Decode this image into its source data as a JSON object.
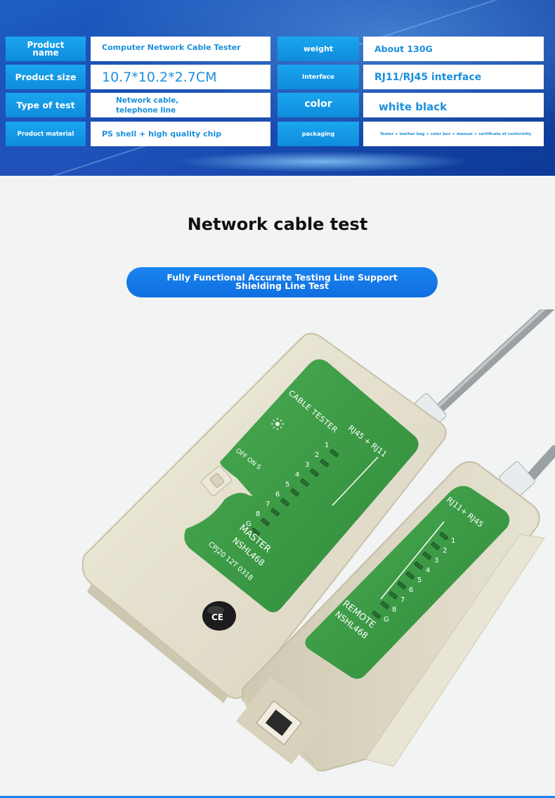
{
  "specs": {
    "product_name": {
      "label": "Product name",
      "value": "Computer Network Cable Tester"
    },
    "weight": {
      "label": "weight",
      "value": "About 130G"
    },
    "product_size": {
      "label": "Product size",
      "value": "10.7*10.2*2.7CM"
    },
    "interface": {
      "label": "Interface",
      "value": "RJ11/RJ45 interface"
    },
    "type_of_test": {
      "label": "Type of test",
      "value": "Network cable, telephone line"
    },
    "color": {
      "label": "color",
      "value": "white black"
    },
    "product_material": {
      "label": "Product material",
      "value": "PS shell + high quality chip"
    },
    "packaging": {
      "label": "packaging",
      "value": "Tester + leather bag + color box + manual + certificate of conformity"
    }
  },
  "section": {
    "title": "Network cable test",
    "pill": "Fully Functional Accurate Testing Line Support Shielding Line Test"
  },
  "device": {
    "master": {
      "header": "CABLE TESTER",
      "port_label": "RJ45 + RJ11",
      "switch_label": "OFF ON S",
      "leds": [
        "1",
        "2",
        "3",
        "4",
        "5",
        "6",
        "7",
        "8",
        "G"
      ],
      "model_title": "MASTER",
      "model": "NSHL468",
      "serial": "CPJ20 12T 0318"
    },
    "remote": {
      "port_label": "RJ11+ RJ45",
      "leds": [
        "1",
        "2",
        "3",
        "4",
        "5",
        "6",
        "7",
        "8",
        "G"
      ],
      "model_title": "REMOTE",
      "model": "NSHL468"
    },
    "ce_mark": "CE"
  },
  "colors": {
    "banner_blue": "#1547a8",
    "label_blue": "#0f8bdc",
    "value_text_blue": "#1b8fdd",
    "pill_blue": "#1b84f0",
    "device_shell": "#e6e2cf",
    "panel_green": "#3c9a45"
  }
}
